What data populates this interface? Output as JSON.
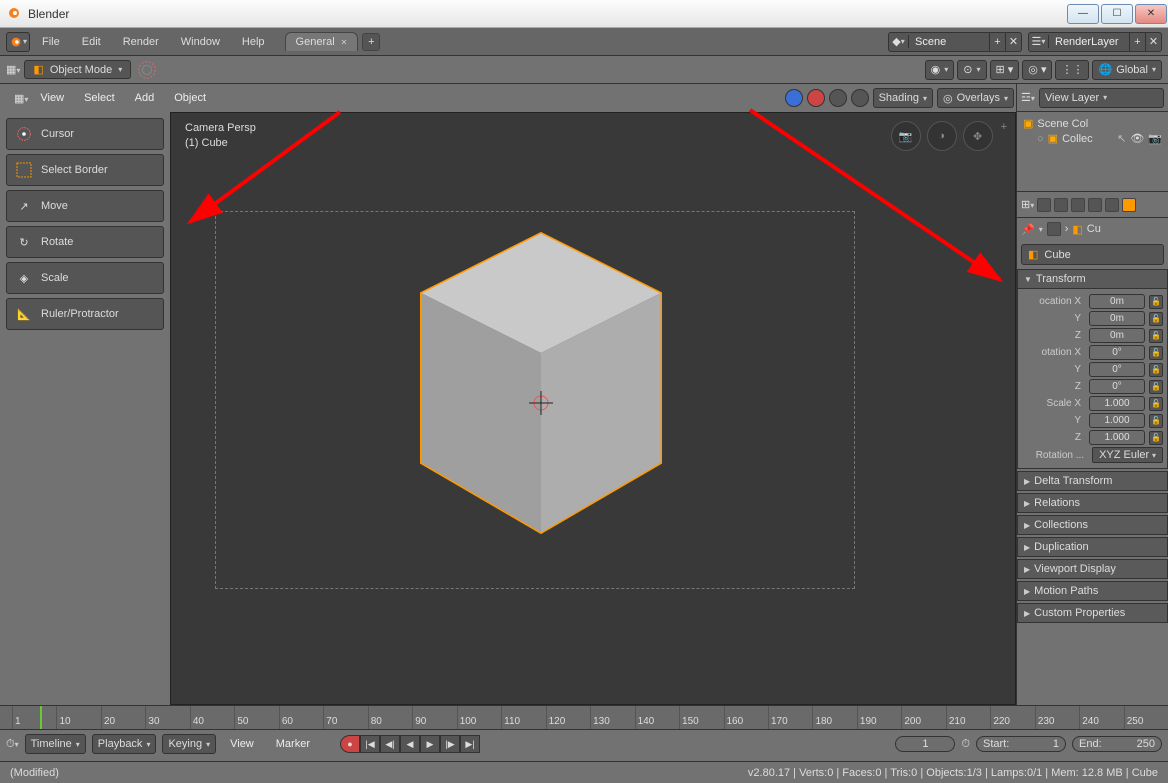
{
  "os_title": "Blender",
  "menubar": [
    "File",
    "Edit",
    "Render",
    "Window",
    "Help"
  ],
  "tab_name": "General",
  "scene_field": "Scene",
  "render_layer_field": "RenderLayer",
  "mode": "Object Mode",
  "global": "Global",
  "viewport_header": {
    "editor": "",
    "menus": [
      "View",
      "Select",
      "Add",
      "Object"
    ],
    "shading": "Shading",
    "overlays": "Overlays"
  },
  "tools": [
    "Cursor",
    "Select Border",
    "Move",
    "Rotate",
    "Scale",
    "Ruler/Protractor"
  ],
  "viewport_info": {
    "cam": "Camera Persp",
    "obj": "(1) Cube"
  },
  "right_header": "View Layer",
  "outliner": {
    "root": "Scene Col",
    "child": "Collec"
  },
  "crumb_obj": "Cu",
  "object_name": "Cube",
  "panels": {
    "transform": "Transform",
    "loc_label": "ocation X",
    "loc_y": "Y",
    "loc_z": "Z",
    "rot_label": "otation X",
    "rot_y": "Y",
    "rot_z": "Z",
    "scale_label": "Scale X",
    "scale_y": "Y",
    "scale_z": "Z",
    "rotmode_label": "Rotation ...",
    "rotmode": "XYZ Euler",
    "loc_vals": [
      "0m",
      "0m",
      "0m"
    ],
    "rot_vals": [
      "0°",
      "0°",
      "0°"
    ],
    "scale_vals": [
      "1.000",
      "1.000",
      "1.000"
    ],
    "collapsed": [
      "Delta Transform",
      "Relations",
      "Collections",
      "Duplication",
      "Viewport Display",
      "Motion Paths",
      "Custom Properties"
    ]
  },
  "timeline": {
    "label": "Timeline",
    "playback": "Playback",
    "keying": "Keying",
    "view": "View",
    "marker": "Marker",
    "frame": "1",
    "start_l": "Start:",
    "start": "1",
    "end_l": "End:",
    "end": "250",
    "ticks": [
      1,
      10,
      20,
      30,
      40,
      50,
      60,
      70,
      80,
      90,
      100,
      110,
      120,
      130,
      140,
      150,
      160,
      170,
      180,
      190,
      200,
      210,
      220,
      230,
      240,
      250
    ]
  },
  "status": {
    "left": "(Modified)",
    "right": "v2.80.17 | Verts:0 | Faces:0 | Tris:0 | Objects:1/3 | Lamps:0/1 | Mem: 12.8 MB | Cube"
  }
}
